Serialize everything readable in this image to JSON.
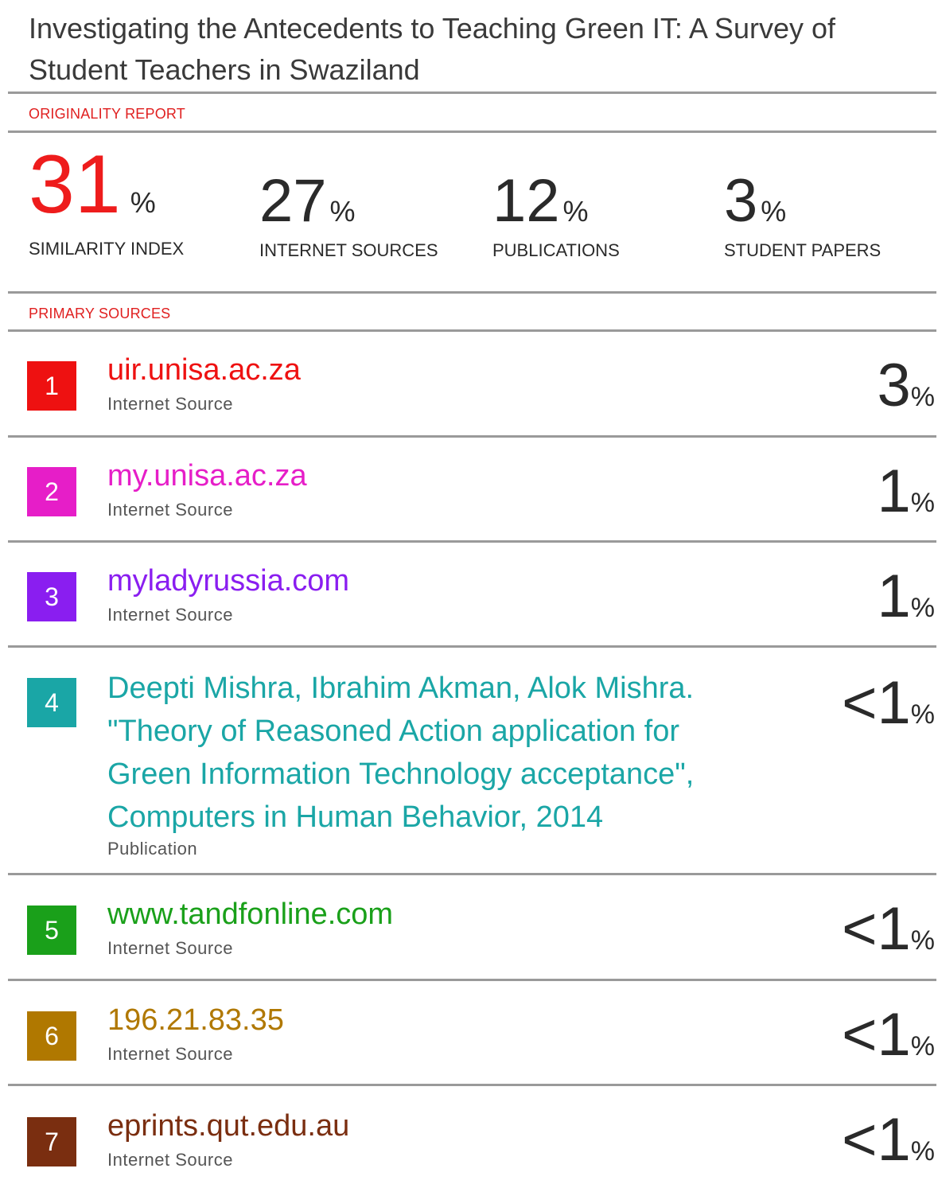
{
  "title": "Investigating the Antecedents to Teaching Green IT: A Survey of Student Teachers in Swaziland",
  "originality_label": "ORIGINALITY REPORT",
  "stats": {
    "similarity": {
      "value": "31",
      "unit": "%",
      "label": "SIMILARITY INDEX"
    },
    "internet": {
      "value": "27",
      "unit": "%",
      "label": "INTERNET SOURCES"
    },
    "publications": {
      "value": "12",
      "unit": "%",
      "label": "PUBLICATIONS"
    },
    "student": {
      "value": "3",
      "unit": "%",
      "label": "STUDENT PAPERS"
    }
  },
  "primary_label": "PRIMARY SOURCES",
  "sources": [
    {
      "num": "1",
      "name": "uir.unisa.ac.za",
      "type": "Internet Source",
      "share": "3",
      "unit": "%",
      "color": "#ee1111"
    },
    {
      "num": "2",
      "name": "my.unisa.ac.za",
      "type": "Internet Source",
      "share": "1",
      "unit": "%",
      "color": "#e61ec8"
    },
    {
      "num": "3",
      "name": "myladyrussia.com",
      "type": "Internet Source",
      "share": "1",
      "unit": "%",
      "color": "#8a1ef0"
    },
    {
      "num": "4",
      "name": "Deepti Mishra, Ibrahim Akman, Alok Mishra. \"Theory of Reasoned Action application for Green Information Technology acceptance\", Computers in Human Behavior, 2014",
      "type": "Publication",
      "share": "<1",
      "unit": "%",
      "color": "#1aa6a6"
    },
    {
      "num": "5",
      "name": "www.tandfonline.com",
      "type": "Internet Source",
      "share": "<1",
      "unit": "%",
      "color": "#1aa01a"
    },
    {
      "num": "6",
      "name": "196.21.83.35",
      "type": "Internet Source",
      "share": "<1",
      "unit": "%",
      "color": "#b07800"
    },
    {
      "num": "7",
      "name": "eprints.qut.edu.au",
      "type": "Internet Source",
      "share": "<1",
      "unit": "%",
      "color": "#7a2e10"
    }
  ]
}
